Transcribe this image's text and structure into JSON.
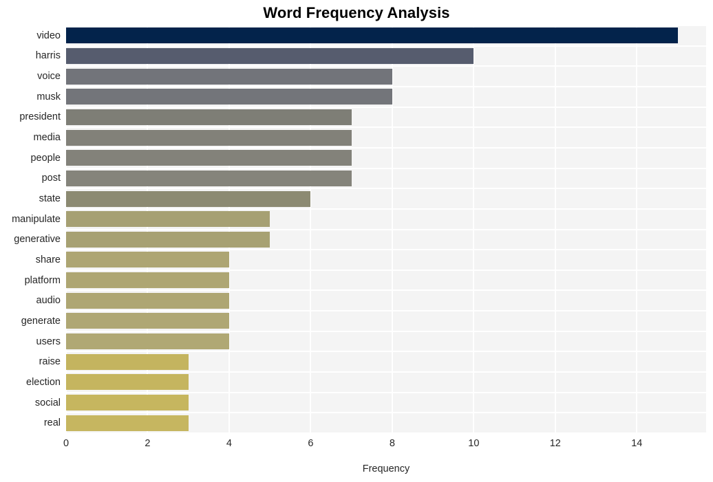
{
  "chart_data": {
    "type": "bar",
    "orientation": "horizontal",
    "title": "Word Frequency Analysis",
    "xlabel": "Frequency",
    "ylabel": "",
    "categories": [
      "video",
      "harris",
      "voice",
      "musk",
      "president",
      "media",
      "people",
      "post",
      "state",
      "manipulate",
      "generative",
      "share",
      "platform",
      "audio",
      "generate",
      "users",
      "raise",
      "election",
      "social",
      "real"
    ],
    "values": [
      15,
      10,
      8,
      8,
      7,
      7,
      7,
      7,
      6,
      5,
      5,
      4,
      4,
      4,
      4,
      4,
      3,
      3,
      3,
      3
    ],
    "bar_colors": [
      "#03234b",
      "#565c6e",
      "#72747a",
      "#73757a",
      "#7e7e76",
      "#828179",
      "#83827a",
      "#85847b",
      "#8c8a72",
      "#a6a073",
      "#a7a173",
      "#ada573",
      "#aea673",
      "#aea673",
      "#afa774",
      "#b0a874",
      "#c4b45f",
      "#c5b55f",
      "#c6b65f",
      "#c6b660"
    ],
    "xticks": [
      0,
      2,
      4,
      6,
      8,
      10,
      12,
      14
    ],
    "xlim": [
      0,
      15.7
    ],
    "x_tick_labels": [
      "0",
      "2",
      "4",
      "6",
      "8",
      "10",
      "12",
      "14"
    ],
    "grid": true,
    "grid_color": "#ffffff",
    "plot_background": "#f4f4f4",
    "figure_background": "#ffffff",
    "legend": null,
    "axis_label_color": "#262626",
    "title_color": "#000000"
  }
}
